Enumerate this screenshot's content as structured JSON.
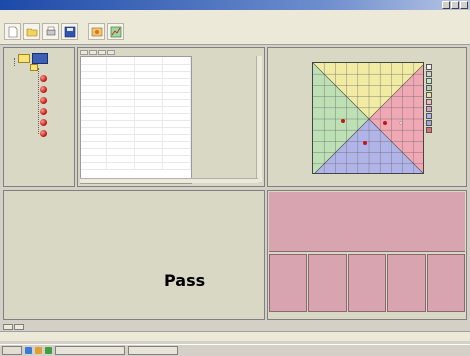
{
  "pass_text": "Pass",
  "colors": {
    "plot_green": "#bde0b5",
    "plot_yellow": "#f2eba3",
    "plot_red": "#f0a8b4",
    "plot_blue": "#b0b4e8",
    "block_pink": "#d8a4b0",
    "marker_red": "#c01818",
    "title_blue": "#1c4aa8"
  },
  "icons": {
    "toolbar": [
      "new-file-icon",
      "open-folder-icon",
      "print-icon",
      "save-icon",
      "settings-icon",
      "chart-icon"
    ],
    "tree": [
      "folder-icon",
      "sample-node-icon"
    ]
  },
  "tree": {
    "child_count": 6
  },
  "table": {
    "row_count": 16
  },
  "plot": {
    "grid_divisions": 10
  }
}
